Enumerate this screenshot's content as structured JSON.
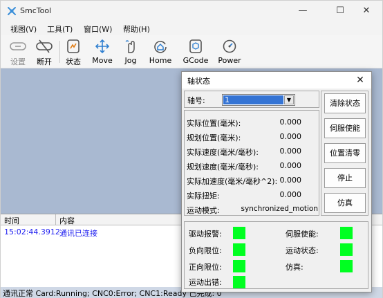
{
  "app": {
    "title": "SmcTool",
    "window_controls": {
      "minimize": "—",
      "maximize": "☐",
      "close": "✕"
    }
  },
  "menu": [
    "视图(V)",
    "工具(T)",
    "窗口(W)",
    "帮助(H)"
  ],
  "toolbar": [
    {
      "label": "设置",
      "icon": "settings-link-icon",
      "enabled": false
    },
    {
      "label": "断开",
      "icon": "disconnect-icon",
      "enabled": true
    },
    {
      "label": "状态",
      "icon": "status-icon",
      "enabled": true
    },
    {
      "label": "Move",
      "icon": "move-icon",
      "enabled": true
    },
    {
      "label": "Jog",
      "icon": "jog-hand-icon",
      "enabled": true
    },
    {
      "label": "Home",
      "icon": "home-icon",
      "enabled": true
    },
    {
      "label": "GCode",
      "icon": "gcode-icon",
      "enabled": true
    },
    {
      "label": "Power",
      "icon": "power-gauge-icon",
      "enabled": true
    }
  ],
  "log": {
    "columns": [
      "时间",
      "内容"
    ],
    "rows": [
      {
        "time": "15:02:44.3912",
        "content": "通讯已连接"
      }
    ]
  },
  "status_bar": "通讯正常  Card:Running; CNC0:Error; CNC1:Ready  已完成: 0",
  "dialog": {
    "title": "轴状态",
    "close": "✕",
    "axis": {
      "label": "轴号:",
      "value": "1"
    },
    "info": [
      {
        "label": "实际位置(毫米):",
        "value": "0.000"
      },
      {
        "label": "规划位置(毫米):",
        "value": "0.000"
      },
      {
        "label": "实际速度(毫米/毫秒):",
        "value": "0.000"
      },
      {
        "label": "规划速度(毫米/毫秒):",
        "value": "0.000"
      },
      {
        "label": "实际加速度(毫米/毫秒^2):",
        "value": "0.000"
      },
      {
        "label": "实际扭矩:",
        "value": "0.000"
      },
      {
        "label": "运动模式:",
        "value": "synchronized_motion"
      }
    ],
    "buttons": [
      "清除状态",
      "伺服使能",
      "位置清零",
      "停止",
      "仿真"
    ],
    "io": {
      "left": [
        "驱动报警:",
        "负向限位:",
        "正向限位:",
        "运动出错:"
      ],
      "right": [
        "伺服使能:",
        "运动状态:",
        "仿真:"
      ],
      "led_color": "#00ff21"
    }
  },
  "colors": {
    "workspace": "#a9b9d1",
    "log_text": "#1c1cf0",
    "status_bar": "#cfd8e6",
    "selection": "#3574d4"
  }
}
